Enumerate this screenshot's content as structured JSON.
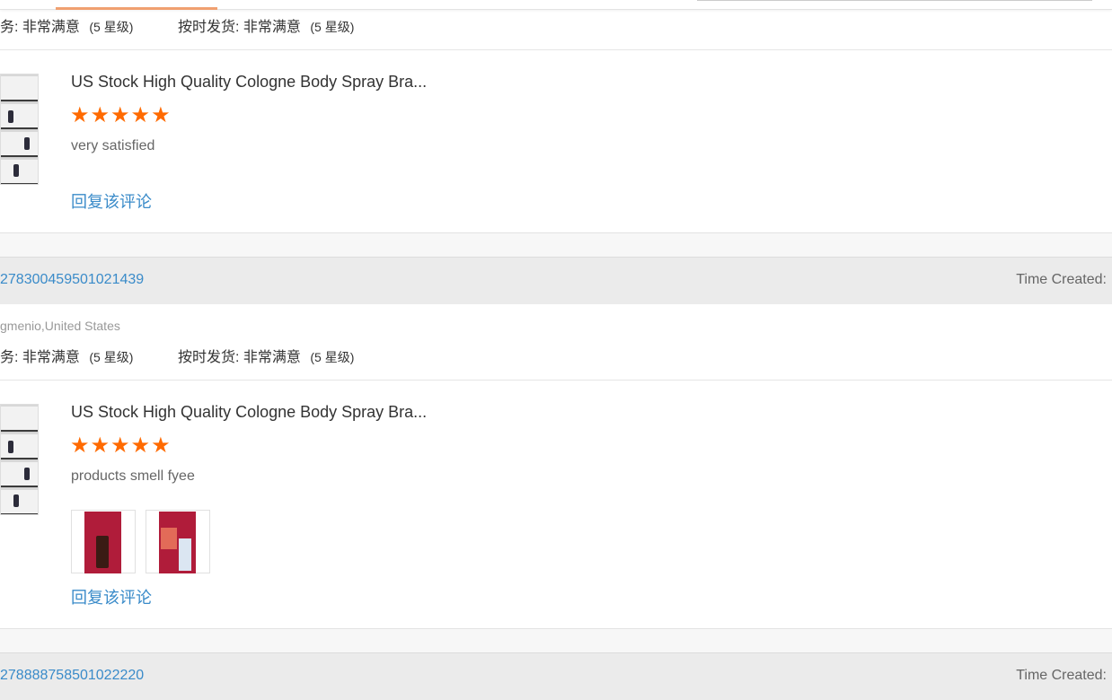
{
  "reviews": [
    {
      "ratings": {
        "service_label": "务:",
        "service_value": "非常满意",
        "service_level": "(5 星级)",
        "ship_label": "按时发货:",
        "ship_value": "非常满意",
        "ship_level": "(5 星级)"
      },
      "product_title": "US Stock High Quality Cologne Body Spray Bra...",
      "stars": 5,
      "comment": "very satisfied",
      "reply_label": "回复该评论"
    },
    {
      "order_id": "278300459501021439",
      "time_created_label": "Time Created:",
      "buyer": "gmenio,United States",
      "ratings": {
        "service_label": "务:",
        "service_value": "非常满意",
        "service_level": "(5 星级)",
        "ship_label": "按时发货:",
        "ship_value": "非常满意",
        "ship_level": "(5 星级)"
      },
      "product_title": "US Stock High Quality Cologne Body Spray Bra...",
      "stars": 5,
      "comment": "products smell fyee",
      "photos": [
        "review-photo-1",
        "review-photo-2"
      ],
      "reply_label": "回复该评论"
    },
    {
      "order_id": "278888758501022220",
      "time_created_label": "Time Created:"
    }
  ],
  "colors": {
    "star": "#ff6a00",
    "link": "#3a8bc9",
    "order_bar": "#ebebeb"
  }
}
